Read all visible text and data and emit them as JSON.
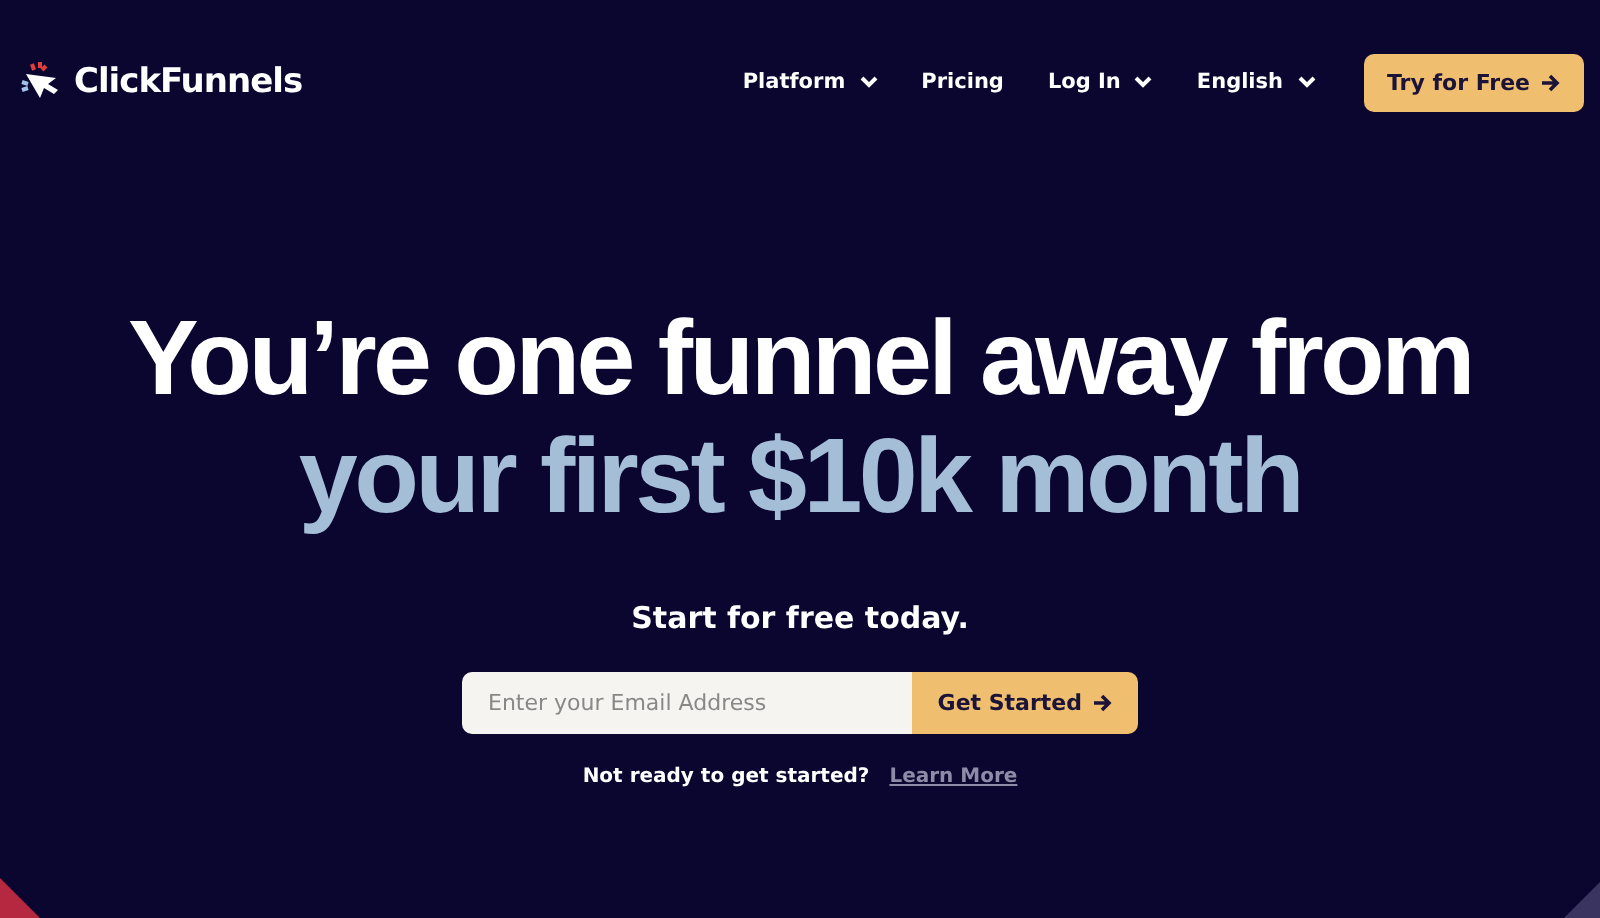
{
  "brand": {
    "name": "ClickFunnels"
  },
  "nav": [
    {
      "label": "Platform",
      "dropdown": true
    },
    {
      "label": "Pricing",
      "dropdown": false
    },
    {
      "label": "Log In",
      "dropdown": true
    },
    {
      "label": "English",
      "dropdown": true
    }
  ],
  "cta_button": "Try for Free",
  "headline": {
    "line_1": "You’re one funnel away from",
    "line_2": "your first $10k month"
  },
  "subheading": "Start for free today.",
  "signup": {
    "placeholder": "Enter your Email Address",
    "button": "Get Started"
  },
  "footnote": {
    "text": "Not ready to get started?",
    "link": "Learn More"
  }
}
